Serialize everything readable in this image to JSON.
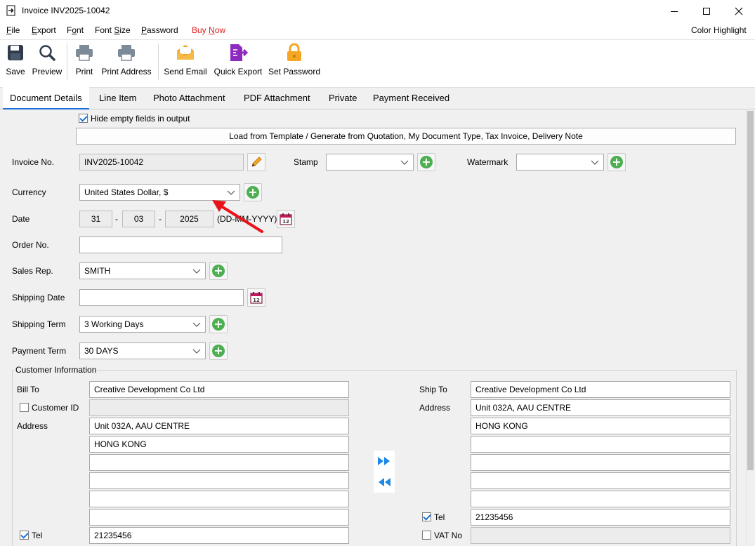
{
  "window": {
    "title": "Invoice INV2025-10042"
  },
  "menu": {
    "items": [
      "File",
      "Export",
      "Font",
      "Font Size",
      "Password",
      "Buy Now"
    ],
    "right": "Color Highlight"
  },
  "toolbar": {
    "save": "Save",
    "preview": "Preview",
    "print": "Print",
    "print_address": "Print Address",
    "send_email": "Send Email",
    "quick_export": "Quick Export",
    "set_password": "Set Password"
  },
  "tabs": [
    "Document Details",
    "Line Item",
    "Photo Attachment",
    "PDF Attachment",
    "Private",
    "Payment Received"
  ],
  "form": {
    "hide_empty_label": "Hide empty fields in output",
    "hide_empty_checked": true,
    "load_template_button": "Load from Template / Generate from Quotation, My Document Type, Tax Invoice, Delivery Note",
    "invoice_no_label": "Invoice No.",
    "invoice_no": "INV2025-10042",
    "stamp_label": "Stamp",
    "stamp_value": "",
    "watermark_label": "Watermark",
    "watermark_value": "",
    "currency_label": "Currency",
    "currency": "United States Dollar, $",
    "date_label": "Date",
    "date_day": "31",
    "date_month": "03",
    "date_year": "2025",
    "date_sep": "-",
    "date_format": "(DD-MM-YYYY)",
    "order_no_label": "Order No.",
    "order_no": "",
    "sales_rep_label": "Sales Rep.",
    "sales_rep": "SMITH",
    "shipping_date_label": "Shipping Date",
    "shipping_date": "",
    "shipping_term_label": "Shipping Term",
    "shipping_term": "3 Working Days",
    "payment_term_label": "Payment Term",
    "payment_term": "30 DAYS"
  },
  "customer": {
    "group_title": "Customer Information",
    "bill_to_label": "Bill To",
    "bill_to": "Creative Development Co Ltd",
    "customer_id_label": "Customer ID",
    "customer_id_checked": false,
    "address_label": "Address",
    "bill_address": [
      "Unit 032A, AAU CENTRE",
      "HONG KONG",
      "",
      "",
      "",
      ""
    ],
    "tel_label": "Tel",
    "tel_checked": true,
    "tel": "21235456",
    "ship_to_label": "Ship To",
    "ship_to": "Creative Development Co Ltd",
    "ship_address_label": "Address",
    "ship_address": [
      "Unit 032A, AAU CENTRE",
      "HONG KONG",
      "",
      "",
      "",
      ""
    ],
    "ship_tel_label": "Tel",
    "ship_tel_checked": true,
    "ship_tel": "21235456",
    "vat_label": "VAT No",
    "vat_checked": false,
    "vat_no": ""
  },
  "colors": {
    "accent": "#1e6fd9",
    "buy_now": "#e02020",
    "add_green": "#4caf50",
    "annotation_arrow": "#e8141b"
  }
}
